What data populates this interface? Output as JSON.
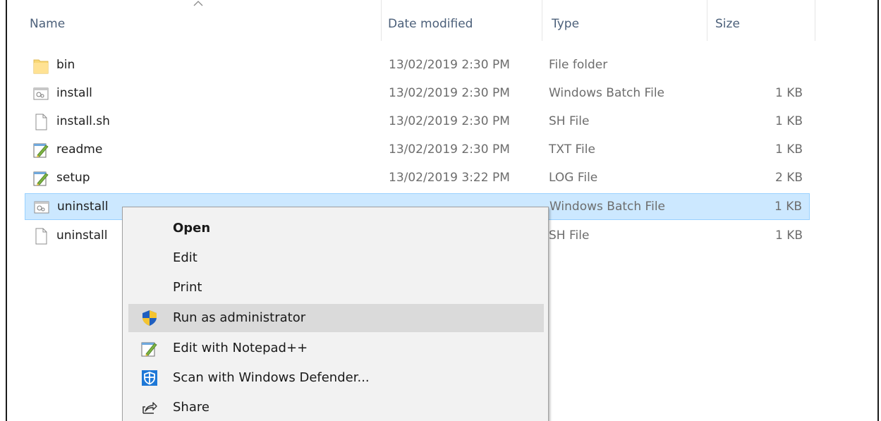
{
  "columns": {
    "name": "Name",
    "date_modified": "Date modified",
    "type": "Type",
    "size": "Size"
  },
  "files": [
    {
      "name": "bin",
      "date": "13/02/2019 2:30 PM",
      "type": "File folder",
      "size": "",
      "icon": "folder-icon"
    },
    {
      "name": "install",
      "date": "13/02/2019 2:30 PM",
      "type": "Windows Batch File",
      "size": "1 KB",
      "icon": "batch-file-icon"
    },
    {
      "name": "install.sh",
      "date": "13/02/2019 2:30 PM",
      "type": "SH File",
      "size": "1 KB",
      "icon": "blank-file-icon"
    },
    {
      "name": "readme",
      "date": "13/02/2019 2:30 PM",
      "type": "TXT File",
      "size": "1 KB",
      "icon": "notepad-file-icon"
    },
    {
      "name": "setup",
      "date": "13/02/2019 3:22 PM",
      "type": "LOG File",
      "size": "2 KB",
      "icon": "notepad-file-icon"
    },
    {
      "name": "uninstall",
      "date": "",
      "type": "Windows Batch File",
      "size": "1 KB",
      "icon": "batch-file-icon"
    },
    {
      "name": "uninstall",
      "date": "",
      "type": "SH File",
      "size": "1 KB",
      "icon": "blank-file-icon"
    }
  ],
  "context_menu": {
    "items": [
      {
        "label": "Open",
        "icon": "",
        "bold": true
      },
      {
        "label": "Edit",
        "icon": ""
      },
      {
        "label": "Print",
        "icon": ""
      },
      {
        "label": "Run as administrator",
        "icon": "uac-shield-icon",
        "hovered": true
      },
      {
        "label": "Edit with Notepad++",
        "icon": "notepad-icon"
      },
      {
        "label": "Scan with Windows Defender...",
        "icon": "defender-icon"
      },
      {
        "label": "Share",
        "icon": "share-icon"
      }
    ]
  },
  "colors": {
    "selection_bg": "#cce8ff",
    "selection_border": "#99d1ff",
    "menu_bg": "#f2f2f2",
    "menu_hover": "#dadada",
    "header_text": "#4c607a"
  }
}
